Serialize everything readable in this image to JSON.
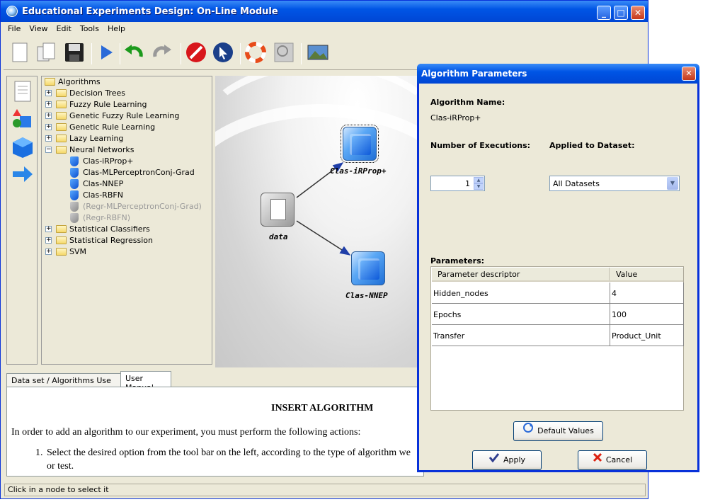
{
  "window": {
    "title": "Educational Experiments Design: On-Line Module"
  },
  "menu": [
    "File",
    "View",
    "Edit",
    "Tools",
    "Help"
  ],
  "tree": {
    "root": "Algorithms",
    "items": [
      {
        "label": "Decision Trees",
        "type": "folder"
      },
      {
        "label": "Fuzzy Rule Learning",
        "type": "folder"
      },
      {
        "label": "Genetic Fuzzy Rule Learning",
        "type": "folder"
      },
      {
        "label": "Genetic Rule Learning",
        "type": "folder"
      },
      {
        "label": "Lazy Learning",
        "type": "folder"
      },
      {
        "label": "Neural Networks",
        "type": "folder-open"
      },
      {
        "label": "Clas-iRProp+",
        "type": "algo"
      },
      {
        "label": "Clas-MLPerceptronConj-Grad",
        "type": "algo"
      },
      {
        "label": "Clas-NNEP",
        "type": "algo"
      },
      {
        "label": "Clas-RBFN",
        "type": "algo"
      },
      {
        "label": "(Regr-MLPerceptronConj-Grad)",
        "type": "algo-disabled"
      },
      {
        "label": "(Regr-RBFN)",
        "type": "algo-disabled"
      },
      {
        "label": "Statistical Classifiers",
        "type": "folder"
      },
      {
        "label": "Statistical Regression",
        "type": "folder"
      },
      {
        "label": "SVM",
        "type": "folder"
      }
    ]
  },
  "canvas": {
    "nodes": {
      "data": "data",
      "irprop": "Clas-iRProp+",
      "nnep": "Clas-NNEP"
    }
  },
  "tabs": {
    "dataset": "Data set / Algorithms Use Case",
    "manual": "User Manual"
  },
  "manual": {
    "heading": "INSERT ALGORITHM",
    "intro": "In order to add an algorithm to our experiment, you must perform the following actions:",
    "step1_num": "1.",
    "step1": "Select the desired option from the tool bar on the left, according to the type of algorithm we",
    "step1_cont": "or test."
  },
  "status": "Click in a node to select it",
  "dialog": {
    "title": "Algorithm Parameters",
    "name_label": "Algorithm Name:",
    "name_value": "Clas-iRProp+",
    "exec_label": "Number of Executions:",
    "exec_value": "1",
    "dataset_label": "Applied to Dataset:",
    "dataset_value": "All Datasets",
    "params_label": "Parameters:",
    "col_desc": "Parameter descriptor",
    "col_value": "Value",
    "rows": [
      {
        "name": "Hidden_nodes",
        "value": "4"
      },
      {
        "name": "Epochs",
        "value": "100"
      },
      {
        "name": "Transfer",
        "value": "Product_Unit"
      }
    ],
    "default_btn": "Default Values",
    "apply_btn": "Apply",
    "cancel_btn": "Cancel"
  }
}
